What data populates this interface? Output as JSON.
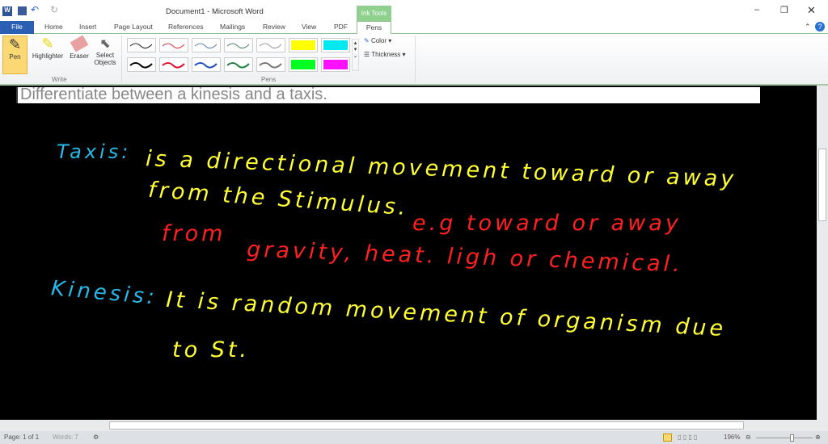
{
  "window": {
    "title": "Document1  -  Microsoft Word",
    "contextual_group": "Ink Tools"
  },
  "tabs": [
    "File",
    "Home",
    "Insert",
    "Page Layout",
    "References",
    "Mailings",
    "Review",
    "View",
    "PDF",
    "Pens"
  ],
  "ribbon": {
    "write": {
      "label": "Write",
      "buttons": [
        "Pen",
        "Highlighter",
        "Eraser",
        "Select Objects"
      ]
    },
    "pens": {
      "label": "Pens",
      "row1": [
        "#222222",
        "#e03040",
        "#6080b0",
        "#508060",
        "#999999",
        "#ffff00",
        "#00e8f0"
      ],
      "row2": [
        "#000000",
        "#e01030",
        "#2050c0",
        "#208040",
        "#777777",
        "#00ff20",
        "#ff10ff"
      ]
    },
    "color_label": "Color",
    "thickness_label": "Thickness"
  },
  "document": {
    "typed_line": "Differentiate between a kinesis and a taxis.",
    "ink": {
      "taxis_label": "Taxis:",
      "l1": "is a directional movement toward or away",
      "l2": "from the Stimulus.",
      "l2r": "e.g  toward or away",
      "l3": "from",
      "l4": "gravity, heat. ligh or chemical.",
      "kinesis_label": "Kinesis:",
      "l5": "It is random movement of organism due",
      "l6": "to St."
    }
  },
  "status": {
    "page": "Page: 1 of 1",
    "words": "Words: 7",
    "zoom": "196%"
  }
}
